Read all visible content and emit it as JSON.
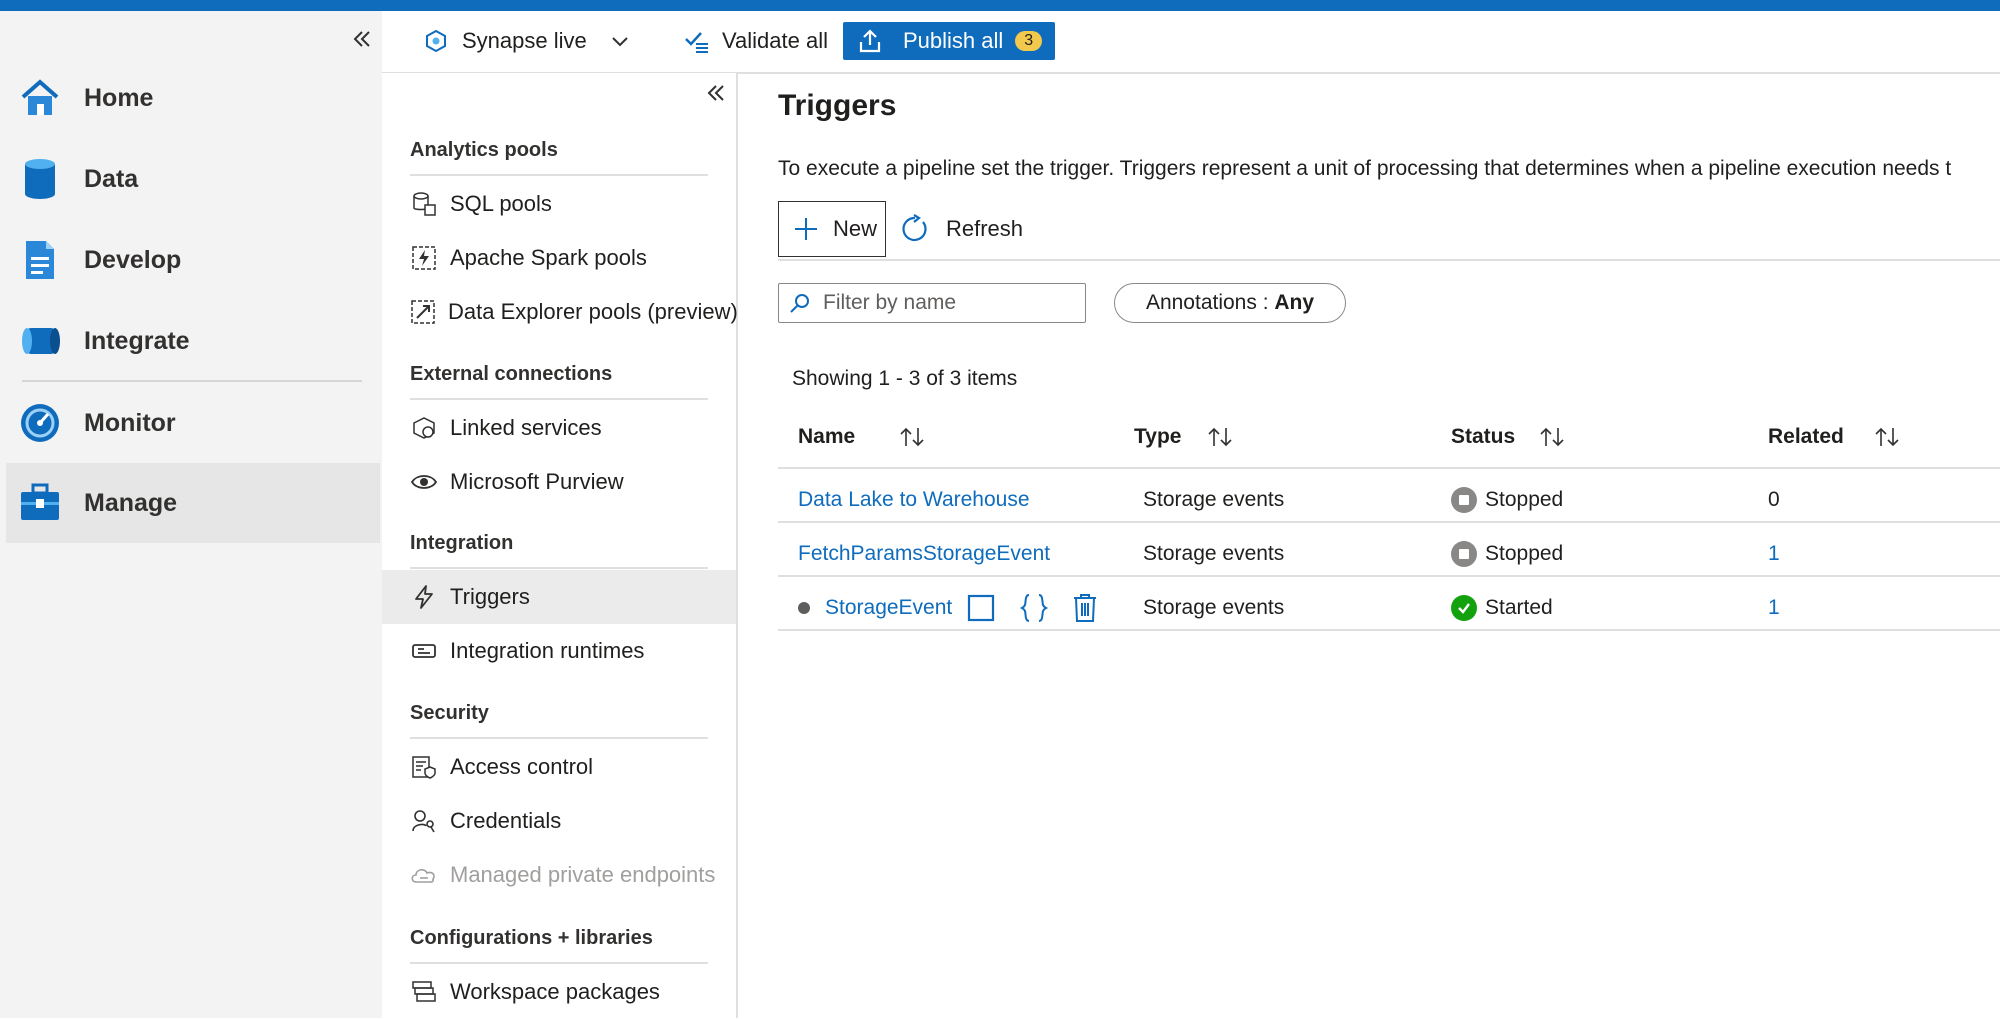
{
  "nav": {
    "collapse_label": "«",
    "items": [
      {
        "label": "Home",
        "icon": "home-icon"
      },
      {
        "label": "Data",
        "icon": "data-icon"
      },
      {
        "label": "Develop",
        "icon": "develop-icon"
      },
      {
        "label": "Integrate",
        "icon": "integrate-icon"
      },
      {
        "label": "Monitor",
        "icon": "monitor-icon"
      },
      {
        "label": "Manage",
        "icon": "manage-icon",
        "active": true
      }
    ]
  },
  "toolbar": {
    "workspace_mode": "Synapse live",
    "validate_label": "Validate all",
    "publish_label": "Publish all",
    "publish_count": "3"
  },
  "subnav": {
    "collapse_label": "«",
    "sections": [
      {
        "title": "Analytics pools",
        "items": [
          "SQL pools",
          "Apache Spark pools",
          "Data Explorer pools (preview)"
        ]
      },
      {
        "title": "External connections",
        "items": [
          "Linked services",
          "Microsoft Purview"
        ]
      },
      {
        "title": "Integration",
        "items": [
          "Triggers",
          "Integration runtimes"
        ]
      },
      {
        "title": "Security",
        "items": [
          "Access control",
          "Credentials",
          "Managed private endpoints"
        ]
      },
      {
        "title": "Configurations + libraries",
        "items": [
          "Workspace packages"
        ]
      }
    ],
    "active_item": "Triggers",
    "disabled_item": "Managed private endpoints"
  },
  "main": {
    "title": "Triggers",
    "description": "To execute a pipeline set the trigger. Triggers represent a unit of processing that determines when a pipeline execution needs t",
    "new_label": "New",
    "refresh_label": "Refresh",
    "filter_placeholder": "Filter by name",
    "annotations_label": "Annotations : ",
    "annotations_value": "Any",
    "showing_text": "Showing 1 - 3 of 3 items",
    "columns": [
      "Name",
      "Type",
      "Status",
      "Related"
    ],
    "rows": [
      {
        "name": "Data Lake to Warehouse",
        "type": "Storage events",
        "status": "Stopped",
        "related": "0"
      },
      {
        "name": "FetchParamsStorageEvent",
        "type": "Storage events",
        "status": "Stopped",
        "related": "1"
      },
      {
        "name": "StorageEvent",
        "type": "Storage events",
        "status": "Started",
        "related": "1"
      }
    ]
  },
  "colors": {
    "accent": "#0f6cbd",
    "badge": "#f2c94c",
    "started": "#13a10e",
    "stopped": "#8a8886"
  }
}
